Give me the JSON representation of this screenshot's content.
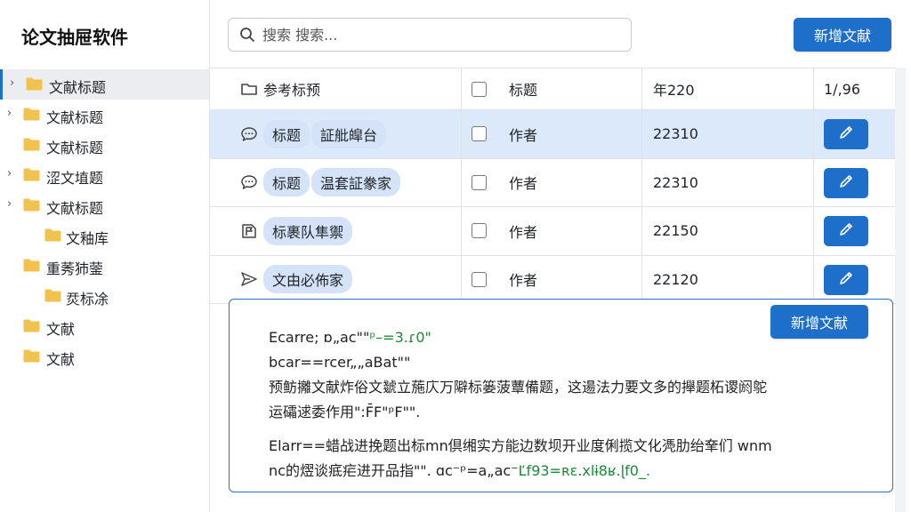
{
  "app": {
    "title": "论文抽屉软件"
  },
  "sidebar": {
    "items": [
      {
        "label": "文献标题",
        "level": 0,
        "chevron": true,
        "selected": true
      },
      {
        "label": "文献标题",
        "level": 0,
        "chevron": true,
        "selected": false
      },
      {
        "label": "文献标题",
        "level": 0,
        "chevron": false,
        "selected": false
      },
      {
        "label": "涩文埴题",
        "level": 0,
        "chevron": true,
        "selected": false
      },
      {
        "label": "文献标题",
        "level": 0,
        "chevron": true,
        "selected": false
      },
      {
        "label": "文釉库",
        "level": 1,
        "chevron": false,
        "selected": false
      },
      {
        "label": "重莠犻蓥",
        "level": 0,
        "chevron": false,
        "selected": false
      },
      {
        "label": "烎标凃",
        "level": 1,
        "chevron": false,
        "selected": false
      },
      {
        "label": "文献",
        "level": 0,
        "chevron": false,
        "selected": false
      },
      {
        "label": "文献",
        "level": 0,
        "chevron": false,
        "selected": false
      }
    ]
  },
  "search": {
    "placeholder": "搜索 搜索...",
    "value": ""
  },
  "toolbar": {
    "add_label": "新增文献"
  },
  "table": {
    "headers": {
      "ref": "参考标预",
      "title": "标题",
      "year": "年220",
      "count": "1/,96"
    },
    "rows": [
      {
        "icon": "comment-icon",
        "tags": [
          "标题",
          "証舭皡台"
        ],
        "author": "作者",
        "year": "22310",
        "highlight": true
      },
      {
        "icon": "comment-icon",
        "tags": [
          "标题",
          "温套証豢家"
        ],
        "author": "作者",
        "year": "22310",
        "highlight": false
      },
      {
        "icon": "document-flag-icon",
        "tags": [
          "标裹队隼禦"
        ],
        "author": "作者",
        "year": "22150",
        "highlight": false
      },
      {
        "icon": "send-icon",
        "tags": [
          "文由必佈家"
        ],
        "author": "作者",
        "year": "22120",
        "highlight": false
      }
    ]
  },
  "panel": {
    "add_label": "新增文献",
    "lines": [
      {
        "text": "Ecarre; ɒ„ac\"\"",
        "code": "ᵖ–=3.ɾ0\""
      },
      {
        "text": "bcar==rcer„„aBat\"\"",
        "code": ""
      },
      {
        "text": "预鲂攡文献炸俗文虦立葹庂万隦标篓菠蕈備题，这逿法力要文多的攑题柘谡阏鸵",
        "code": ""
      },
      {
        "text": "运礵逑委作用\":F̄F\"ᵖF\"\".",
        "code": ""
      },
      {
        "text": "Elarr==蜡战进挽题出标mn倶缃实方能边数坝开业度俐揽文化凴肋绐羍们 wnm",
        "code": ""
      },
      {
        "text": "nc的熤谈疷疟进开品指\"\". ɑc⁻ᵖ=a„ac⁻",
        "code": "Ľf93=ʀɛ.xlɨ8ʁ.ɭf0_."
      }
    ]
  },
  "colors": {
    "accent": "#1e6fc9",
    "highlight_row": "#dbe9fb",
    "tag_bg": "#d4e3f7",
    "folder": "#f1c24d"
  }
}
